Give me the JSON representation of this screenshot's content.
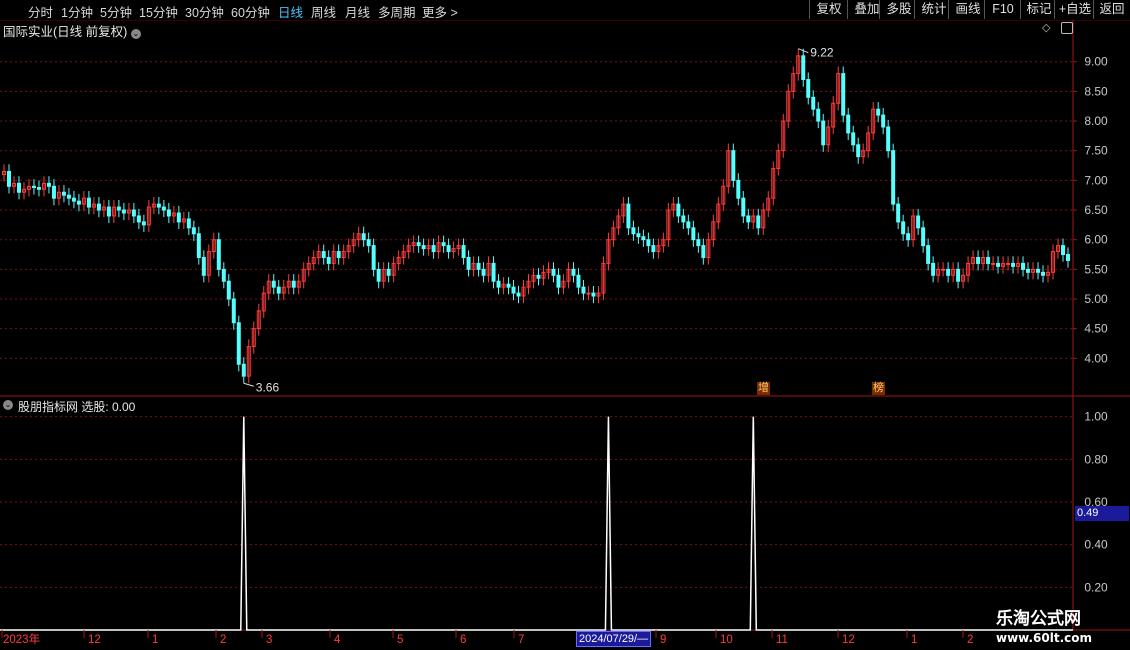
{
  "toolbar": {
    "periods": [
      "分时",
      "1分钟",
      "5分钟",
      "15分钟",
      "30分钟",
      "60分钟",
      "日线",
      "周线",
      "月线",
      "多周期",
      "更多 >"
    ],
    "active": "日线",
    "right_buttons": [
      "复权",
      "叠加",
      "多股",
      "统计",
      "画线",
      "F10",
      "标记",
      "+自选",
      "返回"
    ]
  },
  "main": {
    "title": "国际实业(日线 前复权)",
    "high_label": "9.22",
    "low_label": "3.66",
    "tags": [
      "增",
      "榜"
    ],
    "price_ticks": [
      "9.00",
      "8.50",
      "8.00",
      "7.50",
      "7.00",
      "6.50",
      "6.00",
      "5.50",
      "5.00",
      "4.50",
      "4.00"
    ]
  },
  "indicator": {
    "title": "股朋指标网 选股: 0.00",
    "ticks": [
      "1.00",
      "0.80",
      "0.60",
      "0.40",
      "0.20"
    ],
    "cursor_value": "0.49"
  },
  "xaxis": {
    "labels": [
      "2023年",
      "12",
      "1",
      "2",
      "3",
      "4",
      "5",
      "6",
      "7",
      "9",
      "10",
      "11",
      "12",
      "1",
      "2"
    ],
    "cursor_date": "2024/07/29/—"
  },
  "watermark": {
    "line1": "乐淘公式网",
    "line2": "www.60lt.com"
  },
  "colors": {
    "up": "#ff3b3b",
    "down": "#54ffff",
    "grid": "#7a1010",
    "border": "#a01818"
  },
  "chart_data": {
    "type": "candlestick",
    "ylim": [
      3.5,
      9.4
    ],
    "closes": [
      7.15,
      6.9,
      6.95,
      6.8,
      6.85,
      6.9,
      6.88,
      6.85,
      6.95,
      6.9,
      6.7,
      6.8,
      6.75,
      6.7,
      6.65,
      6.6,
      6.7,
      6.55,
      6.6,
      6.5,
      6.55,
      6.4,
      6.55,
      6.5,
      6.45,
      6.5,
      6.4,
      6.3,
      6.25,
      6.55,
      6.6,
      6.55,
      6.5,
      6.4,
      6.45,
      6.3,
      6.35,
      6.2,
      6.1,
      5.7,
      5.4,
      5.8,
      6.0,
      5.5,
      5.3,
      5.0,
      4.6,
      3.9,
      3.7,
      4.2,
      4.5,
      4.8,
      5.1,
      5.3,
      5.2,
      5.1,
      5.2,
      5.3,
      5.2,
      5.3,
      5.5,
      5.6,
      5.7,
      5.8,
      5.7,
      5.6,
      5.8,
      5.7,
      5.8,
      5.9,
      6.0,
      6.1,
      6.0,
      5.9,
      5.5,
      5.3,
      5.5,
      5.4,
      5.6,
      5.7,
      5.8,
      5.9,
      5.95,
      5.9,
      5.85,
      5.9,
      5.8,
      5.95,
      5.9,
      5.8,
      5.85,
      5.9,
      5.7,
      5.5,
      5.6,
      5.5,
      5.4,
      5.6,
      5.3,
      5.2,
      5.25,
      5.2,
      5.1,
      5.05,
      5.2,
      5.3,
      5.4,
      5.35,
      5.45,
      5.5,
      5.4,
      5.2,
      5.3,
      5.5,
      5.4,
      5.2,
      5.1,
      5.1,
      5.05,
      5.1,
      5.6,
      6.0,
      6.2,
      6.4,
      6.6,
      6.2,
      6.1,
      6.05,
      6.0,
      5.9,
      5.8,
      5.9,
      6.0,
      6.5,
      6.6,
      6.4,
      6.3,
      6.2,
      6.0,
      5.9,
      5.7,
      6.0,
      6.3,
      6.6,
      6.9,
      7.5,
      7.0,
      6.7,
      6.4,
      6.3,
      6.4,
      6.2,
      6.5,
      6.7,
      7.2,
      7.5,
      8.0,
      8.5,
      8.8,
      9.1,
      8.7,
      8.4,
      8.2,
      8.0,
      7.6,
      7.9,
      8.3,
      8.8,
      8.1,
      7.8,
      7.6,
      7.4,
      7.5,
      7.8,
      8.2,
      8.1,
      7.9,
      7.5,
      6.6,
      6.3,
      6.1,
      6.0,
      6.4,
      6.2,
      5.9,
      5.6,
      5.4,
      5.5,
      5.5,
      5.4,
      5.5,
      5.3,
      5.4,
      5.6,
      5.7,
      5.6,
      5.7,
      5.6,
      5.6,
      5.55,
      5.6,
      5.6,
      5.55,
      5.6,
      5.5,
      5.45,
      5.5,
      5.45,
      5.4,
      5.45,
      5.8,
      5.9,
      5.75,
      5.65
    ],
    "signals": [
      {
        "index": 48,
        "value": 1.0
      },
      {
        "index": 121,
        "value": 1.0
      },
      {
        "index": 150,
        "value": 1.0
      }
    ],
    "indicator_ylim": [
      0,
      1.05
    ]
  }
}
